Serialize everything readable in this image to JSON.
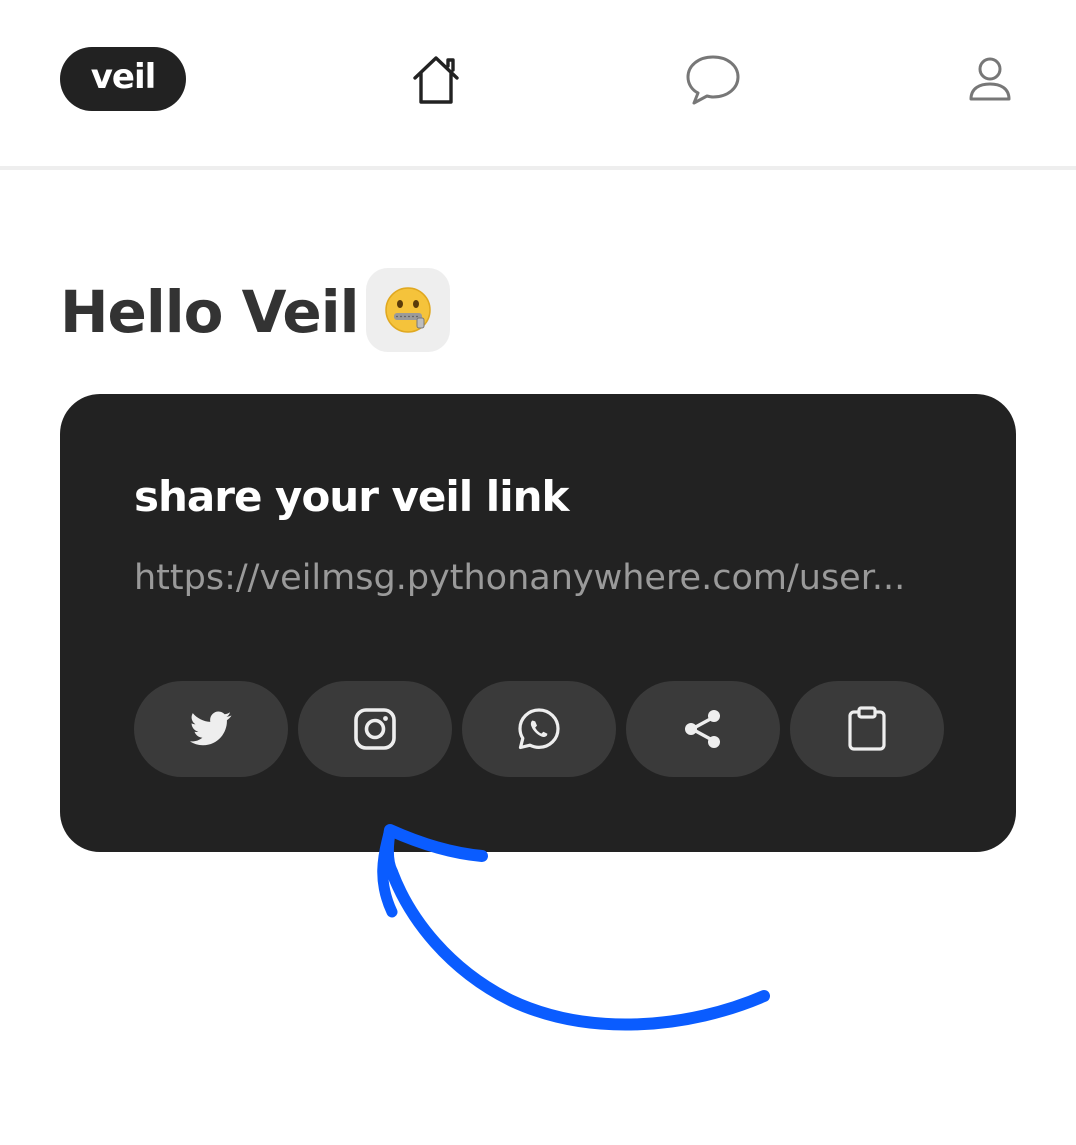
{
  "topbar": {
    "logo_text": "veil",
    "icons": [
      "home-icon",
      "chat-icon",
      "profile-icon"
    ]
  },
  "main": {
    "greeting": "Hello Veil",
    "greeting_emoji": "🤐"
  },
  "share_card": {
    "title": "share your veil link",
    "link": "https://veilmsg.pythonanywhere.com/user...",
    "buttons": [
      "twitter-icon",
      "instagram-icon",
      "whatsapp-icon",
      "share-icon",
      "clipboard-icon"
    ]
  },
  "colors": {
    "dark": "#222222",
    "button_bg": "#3a3a3a",
    "link_text": "#9a9a9a",
    "arrow": "#0a5cff"
  }
}
